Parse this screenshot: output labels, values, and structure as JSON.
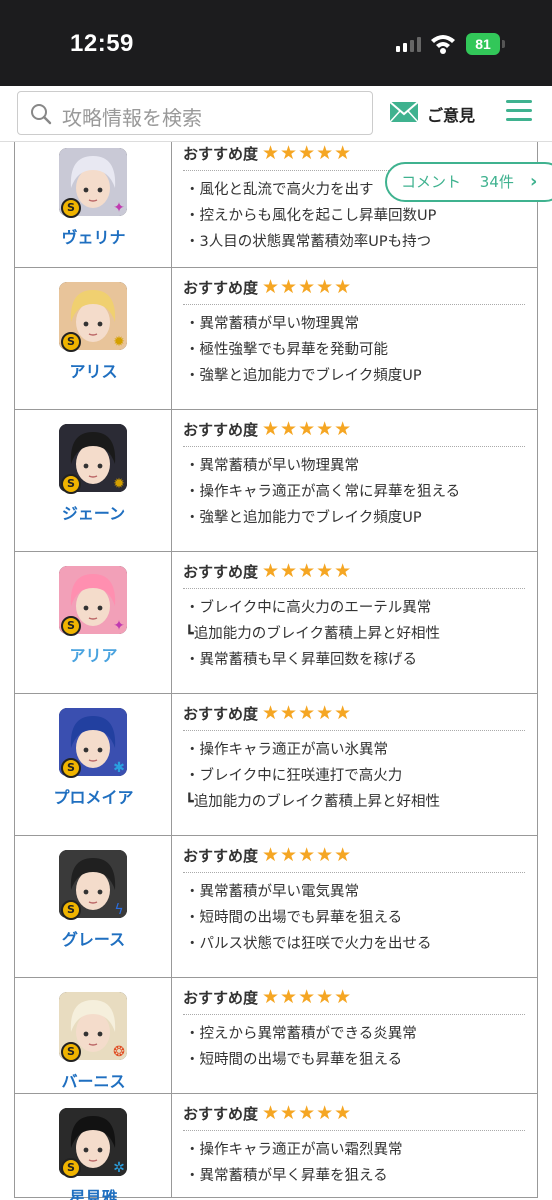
{
  "status": {
    "time": "12:59",
    "battery": "81"
  },
  "header": {
    "search_placeholder": "攻略情報を検索",
    "opinion_label": "ご意見"
  },
  "comment": {
    "label": "コメント",
    "count": "34件"
  },
  "rec_label": "おすすめ度",
  "stars": "★★★★★",
  "rows": [
    {
      "name": "ヴェリナ",
      "attr_icon": "ether-icon",
      "points": [
        "・風化と乱流で高火力を出す",
        "・控えからも風化を起こし昇華回数UP",
        "・3人目の状態異常蓄積効率UPも持つ"
      ]
    },
    {
      "name": "アリス",
      "attr_icon": "physical-icon",
      "points": [
        "・異常蓄積が早い物理異常",
        "・極性強撃でも昇華を発動可能",
        "・強撃と追加能力でブレイク頻度UP"
      ]
    },
    {
      "name": "ジェーン",
      "attr_icon": "physical-icon",
      "points": [
        "・異常蓄積が早い物理異常",
        "・操作キャラ適正が高く常に昇華を狙える",
        "・強撃と追加能力でブレイク頻度UP"
      ]
    },
    {
      "name": "アリア",
      "attr_icon": "ether-icon",
      "points": [
        "・ブレイク中に高火力のエーテル異常",
        "┗追加能力のブレイク蓄積上昇と好相性",
        "・異常蓄積も早く昇華回数を稼げる"
      ]
    },
    {
      "name": "プロメイア",
      "attr_icon": "ice-icon",
      "points": [
        "・操作キャラ適正が高い氷異常",
        "・ブレイク中に狂咲連打で高火力",
        "┗追加能力のブレイク蓄積上昇と好相性"
      ]
    },
    {
      "name": "グレース",
      "attr_icon": "electric-icon",
      "points": [
        "・異常蓄積が早い電気異常",
        "・短時間の出場でも昇華を狙える",
        "・パルス状態では狂咲で火力を出せる"
      ]
    },
    {
      "name": "バーニス",
      "attr_icon": "fire-icon",
      "points": [
        "・控えから異常蓄積ができる炎異常",
        "・短時間の出場でも昇華を狙える"
      ]
    },
    {
      "name": "星見雅",
      "attr_icon": "frost-icon",
      "points": [
        "・操作キャラ適正が高い霜烈異常",
        "・異常蓄積が早く昇華を狙える"
      ]
    }
  ]
}
